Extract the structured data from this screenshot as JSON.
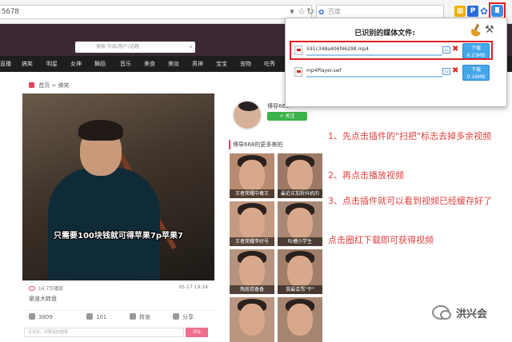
{
  "browser": {
    "url": "5678",
    "search_placeholder": "百度",
    "toolbar_icons": [
      "dropdown-icon",
      "star-icon",
      "refresh-icon"
    ],
    "extensions": [
      {
        "name": "grid-extension",
        "color": "#f2b200",
        "glyph": "▦"
      },
      {
        "name": "p-extension",
        "color": "#2a6ad9",
        "glyph": "P"
      },
      {
        "name": "paw-extension",
        "color": "#3c78d8",
        "glyph": "✿"
      },
      {
        "name": "media-sniffer-extension",
        "color": "#3a8fe4",
        "glyph": ""
      }
    ]
  },
  "site": {
    "search_placeholder": "搜索 作品/用户/话题",
    "nav": [
      "直播",
      "搞笑",
      "明星",
      "女神",
      "舞蹈",
      "音乐",
      "美食",
      "美妆",
      "男神",
      "宝宝",
      "宠物",
      "吃秀"
    ],
    "breadcrumb": {
      "home": "首页",
      "sep": ">",
      "current": "搞笑"
    }
  },
  "video": {
    "subtitle": "只需要100块钱就可得苹果7p苹果7",
    "views": "14.7万播放",
    "date": "05-17 19:24",
    "caption": "渠道大转盘",
    "likes": "3809",
    "comments": "101",
    "share_label": "转发",
    "share2_label": "分享",
    "comment_placeholder": "写评论，你要说的感受",
    "comment_button": "评论"
  },
  "uploader": {
    "name": "博导668",
    "follow": "+ 关注",
    "more_title": "博导668的更多美拍"
  },
  "thumbs": [
    {
      "caption": "王者荣耀中毒王"
    },
    {
      "caption": "最近买加拆抖机的"
    },
    {
      "caption": ""
    },
    {
      "caption": ""
    },
    {
      "caption": "王者荣耀李好号"
    },
    {
      "caption": "吐槽小学生"
    },
    {
      "caption": ""
    },
    {
      "caption": ""
    },
    {
      "caption": "掏底捞香香"
    },
    {
      "caption": "我最会骂\"干\""
    },
    {
      "caption": ""
    },
    {
      "caption": ""
    }
  ],
  "popup": {
    "title": "已识别的媒体文件:",
    "files": [
      {
        "name": "591c348a406f46298.mp4",
        "btn_top": "下载",
        "btn_bottom": "6.23MB"
      },
      {
        "name": "mp4Player.swf",
        "btn_top": "下载",
        "btn_bottom": "0.16MB"
      }
    ]
  },
  "annotations": [
    "1、先点击插件的\"扫把\"标志去掉多余视频",
    "2、再点击播放视频",
    "3、点击插件就可以看到视频已经缓存好了",
    "点击圈红下载即可获得视频"
  ],
  "watermark": "洪兴会"
}
